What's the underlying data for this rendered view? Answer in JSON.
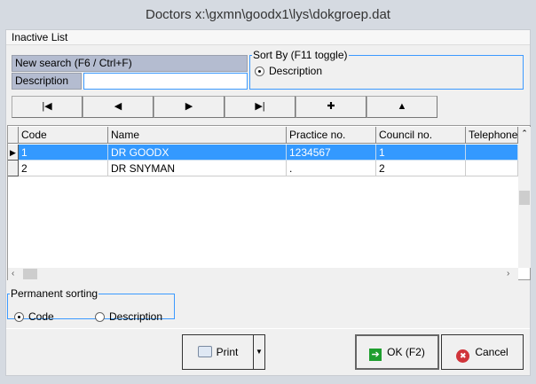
{
  "window": {
    "title": "Doctors  x:\\gxmn\\goodx1\\lys\\dokgroep.dat"
  },
  "header": {
    "label": "Inactive List"
  },
  "search": {
    "label": "New search (F6 / Ctrl+F)",
    "field_label": "Description",
    "value": ""
  },
  "sort_by": {
    "legend": "Sort By (F11 toggle)",
    "options": [
      {
        "label": "Description",
        "selected": true
      }
    ]
  },
  "nav_buttons": [
    {
      "name": "first",
      "glyph": "|◀"
    },
    {
      "name": "previous",
      "glyph": "◀"
    },
    {
      "name": "next",
      "glyph": "▶"
    },
    {
      "name": "last",
      "glyph": "▶|"
    },
    {
      "name": "add",
      "glyph": "✚"
    },
    {
      "name": "up",
      "glyph": "▲"
    }
  ],
  "grid": {
    "columns": [
      "Code",
      "Name",
      "Practice no.",
      "Council no.",
      "Telephone"
    ],
    "rows": [
      {
        "code": "1",
        "name": "DR GOODX",
        "practice": "1234567",
        "council": "1",
        "telephone": "",
        "selected": true
      },
      {
        "code": "2",
        "name": "DR SNYMAN",
        "practice": ".",
        "council": "2",
        "telephone": "",
        "selected": false
      }
    ]
  },
  "permanent_sorting": {
    "legend": "Permanent sorting",
    "options": [
      {
        "label": "Code",
        "selected": true
      },
      {
        "label": "Description",
        "selected": false
      }
    ]
  },
  "footer": {
    "print": "Print",
    "ok": "OK (F2)",
    "cancel": "Cancel"
  },
  "colors": {
    "selection": "#3399ff",
    "focus_border": "#3c9aff"
  }
}
